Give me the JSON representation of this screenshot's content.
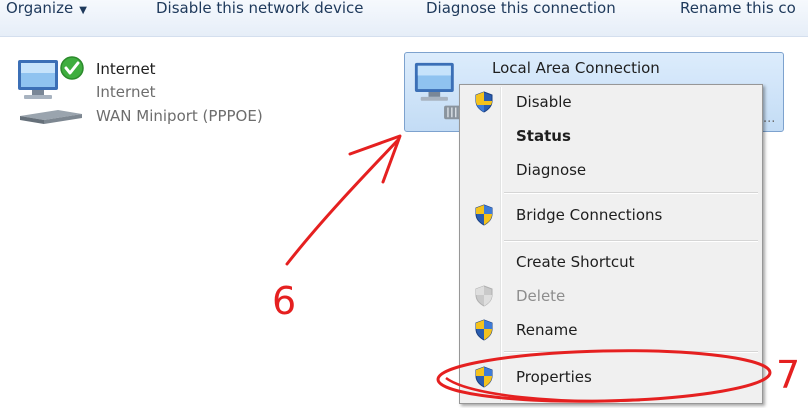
{
  "toolbar": {
    "organize": "Organize",
    "disable": "Disable this network device",
    "diagnose": "Diagnose this connection",
    "rename": "Rename this co"
  },
  "connections": {
    "internet": {
      "name": "Internet",
      "type": "Internet",
      "device": "WAN Miniport (PPPOE)"
    },
    "lan": {
      "name": "Local Area Connection",
      "truncated": "..."
    }
  },
  "context_menu": {
    "items": [
      {
        "label": "Disable",
        "shield": true
      },
      {
        "label": "Status",
        "bold": true
      },
      {
        "label": "Diagnose"
      },
      {
        "label": "Bridge Connections",
        "shield": true
      },
      {
        "label": "Create Shortcut"
      },
      {
        "label": "Delete",
        "shield": true,
        "disabled": true
      },
      {
        "label": "Rename",
        "shield": true
      },
      {
        "label": "Properties",
        "shield": true,
        "highlighted_by_annotation": true
      }
    ]
  },
  "annotations": {
    "step_6": "6",
    "step_7": "7",
    "color": "#e52020"
  }
}
